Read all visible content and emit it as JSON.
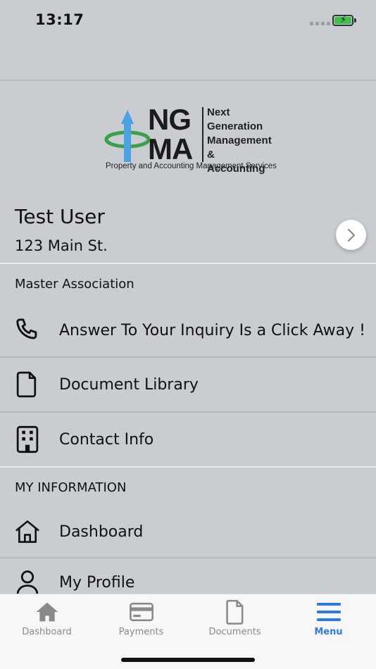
{
  "status_bar": {
    "time": "13:17"
  },
  "logo": {
    "letters_top": "NG",
    "letters_bottom": "MA",
    "line1": "Next",
    "line2": "Generation",
    "line3": "Management",
    "line4": "& Accounting",
    "tagline": "Property and Accounting Management Services"
  },
  "user": {
    "name": "Test User",
    "address": "123 Main St."
  },
  "sections": {
    "association": "Master Association",
    "my_information": "MY INFORMATION"
  },
  "menu": {
    "inquiry": "Answer To Your Inquiry Is a Click Away !",
    "documents": "Document Library",
    "contact": "Contact Info",
    "dashboard": "Dashboard",
    "profile": "My Profile"
  },
  "tabs": {
    "dashboard": "Dashboard",
    "payments": "Payments",
    "documents": "Documents",
    "menu": "Menu"
  },
  "colors": {
    "active_tab": "#2f7be5",
    "inactive_tab": "#8a8a8a",
    "background": "#c9cdd2"
  }
}
